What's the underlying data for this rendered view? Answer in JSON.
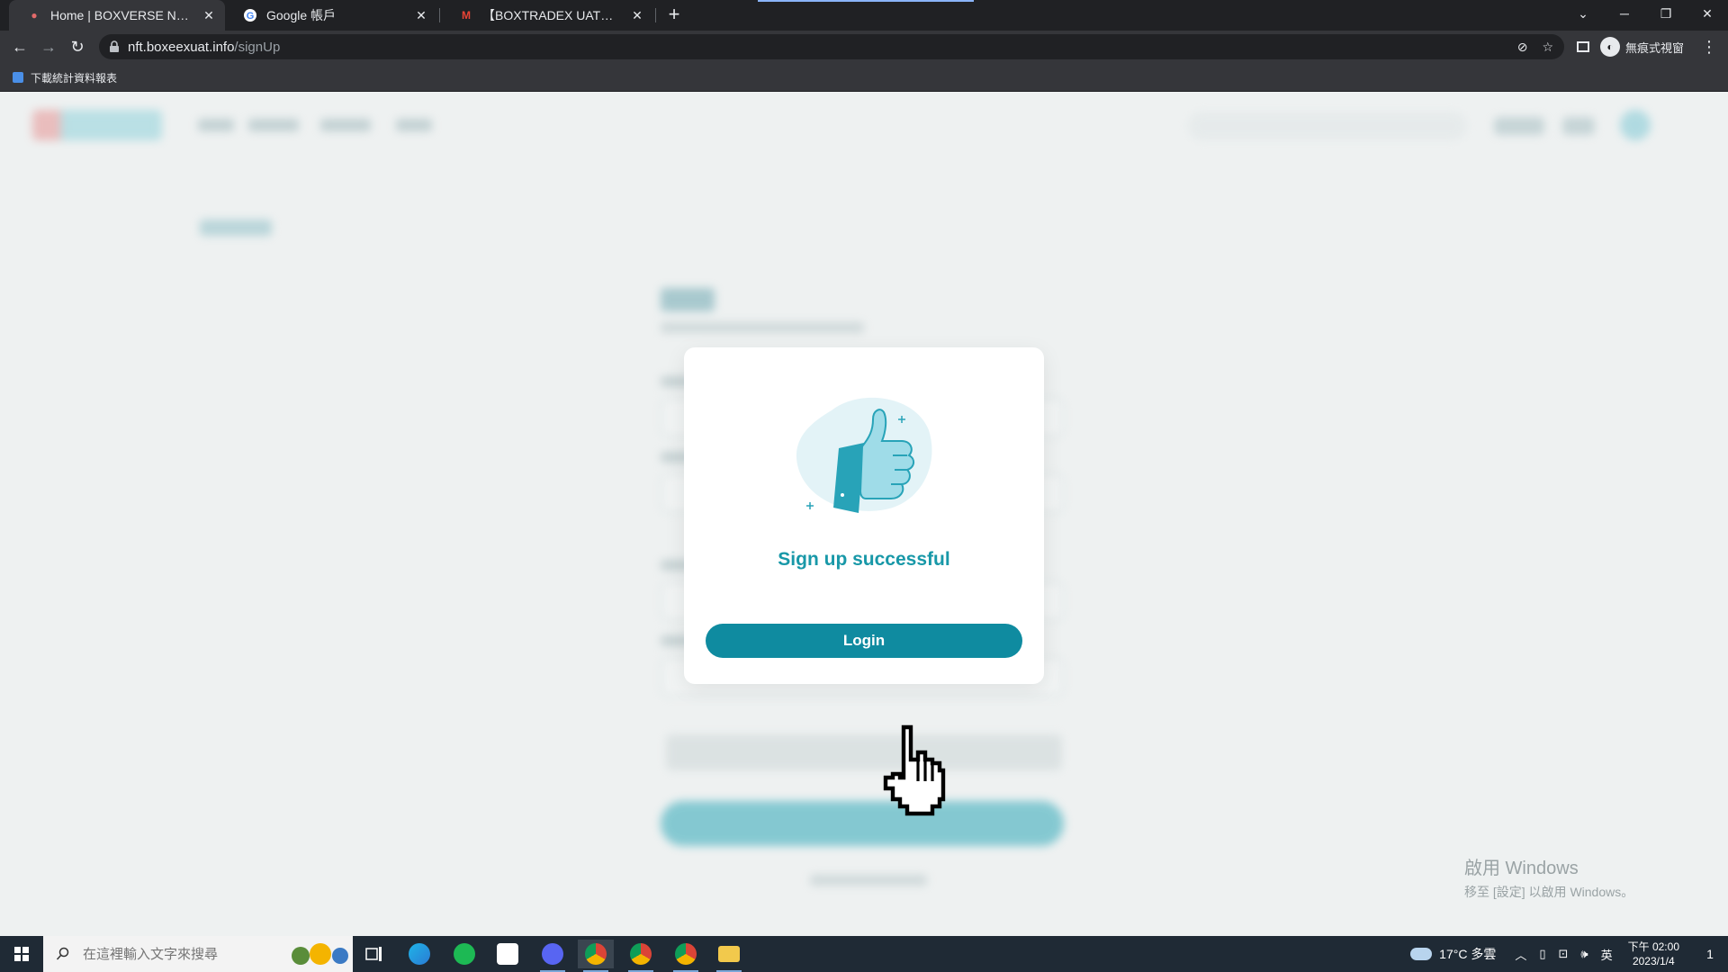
{
  "browser": {
    "tabs": [
      {
        "title": "Home | BOXVERSE NFT Market",
        "active": true
      },
      {
        "title": "Google 帳戶",
        "active": false
      },
      {
        "title": "【BOXTRADEX UAT】Email ver",
        "active": false
      }
    ],
    "url_host": "nft.boxeexuat.info",
    "url_path": "/signUp",
    "profile_label": "無痕式視窗",
    "bookmark": "下載統計資料報表"
  },
  "modal": {
    "title": "Sign up successful",
    "login_label": "Login"
  },
  "watermark": {
    "line1": "啟用 Windows",
    "line2": "移至 [設定] 以啟用 Windows。"
  },
  "taskbar": {
    "search_placeholder": "在這裡輸入文字來搜尋",
    "weather": "17°C  多雲",
    "ime": "英",
    "time": "下午 02:00",
    "date": "2023/1/4",
    "notifications": "1"
  },
  "colors": {
    "accent": "#0f8ba0",
    "success_text": "#1898a8",
    "illustration_bg": "#e3f3f7",
    "thumb": "#9fdce8"
  }
}
